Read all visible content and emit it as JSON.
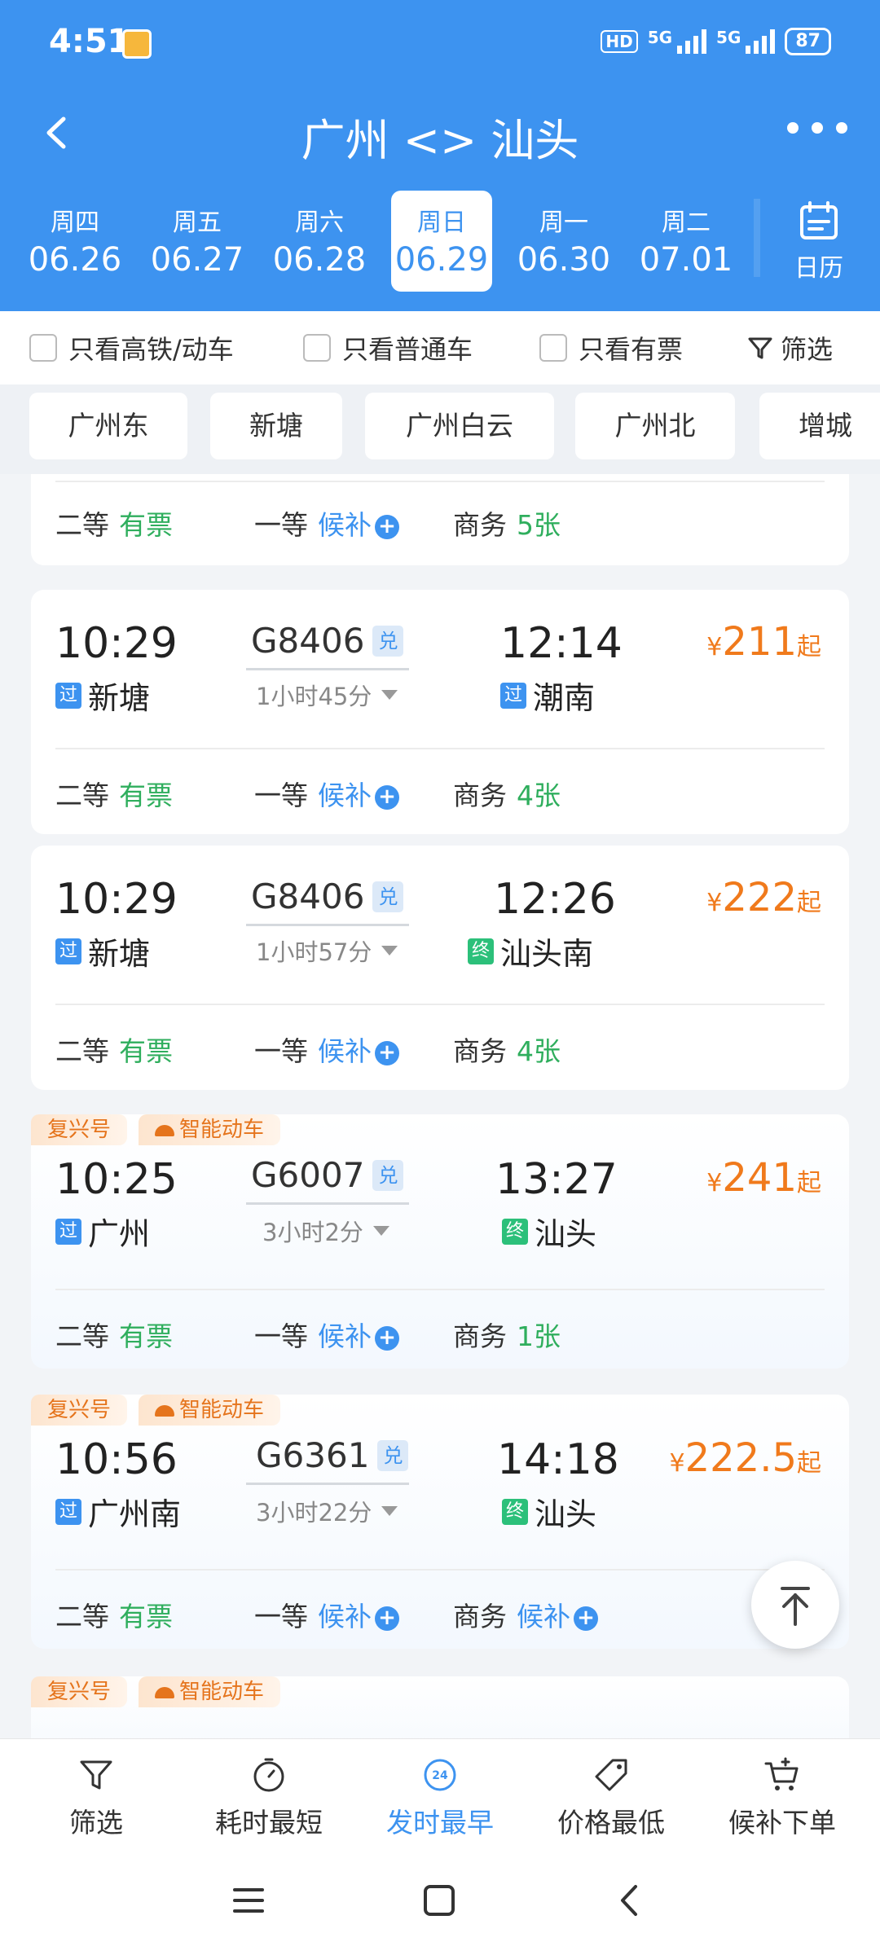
{
  "status": {
    "time": "4:51",
    "hd": "HD",
    "net1": "5G",
    "net2": "5G",
    "battery": "87"
  },
  "header": {
    "title": "广州 <> 汕头",
    "calendar_label": "日历"
  },
  "dates": [
    {
      "weekday": "周四",
      "date": "06.26",
      "selected": false
    },
    {
      "weekday": "周五",
      "date": "06.27",
      "selected": false
    },
    {
      "weekday": "周六",
      "date": "06.28",
      "selected": false
    },
    {
      "weekday": "周日",
      "date": "06.29",
      "selected": true
    },
    {
      "weekday": "周一",
      "date": "06.30",
      "selected": false
    },
    {
      "weekday": "周二",
      "date": "07.01",
      "selected": false
    }
  ],
  "filters": {
    "high_speed": "只看高铁/动车",
    "normal": "只看普通车",
    "available": "只看有票",
    "filter": "筛选"
  },
  "stations": [
    "广州东",
    "新塘",
    "广州白云",
    "广州北",
    "增城"
  ],
  "partial_card": {
    "seats": [
      {
        "class": "二等",
        "status": "有票",
        "type": "available"
      },
      {
        "class": "一等",
        "status": "候补",
        "type": "waitlist"
      },
      {
        "class": "商务",
        "status": "5张",
        "type": "available"
      }
    ]
  },
  "trains": [
    {
      "badges": [],
      "dep_time": "10:29",
      "dep_tag": "过",
      "dep_station": "新塘",
      "train_no": "G8406",
      "dui": "兑",
      "duration": "1小时45分",
      "arr_time": "12:14",
      "arr_tag": "过",
      "arr_station": "潮南",
      "price_currency": "¥",
      "price": "211",
      "price_suffix": "起",
      "seats": [
        {
          "class": "二等",
          "status": "有票",
          "type": "available"
        },
        {
          "class": "一等",
          "status": "候补",
          "type": "waitlist"
        },
        {
          "class": "商务",
          "status": "4张",
          "type": "available"
        }
      ]
    },
    {
      "badges": [],
      "dep_time": "10:29",
      "dep_tag": "过",
      "dep_station": "新塘",
      "train_no": "G8406",
      "dui": "兑",
      "duration": "1小时57分",
      "arr_time": "12:26",
      "arr_tag": "终",
      "arr_station": "汕头南",
      "price_currency": "¥",
      "price": "222",
      "price_suffix": "起",
      "seats": [
        {
          "class": "二等",
          "status": "有票",
          "type": "available"
        },
        {
          "class": "一等",
          "status": "候补",
          "type": "waitlist"
        },
        {
          "class": "商务",
          "status": "4张",
          "type": "available"
        }
      ]
    },
    {
      "badges": [
        "复兴号",
        "智能动车"
      ],
      "dep_time": "10:25",
      "dep_tag": "过",
      "dep_station": "广州",
      "train_no": "G6007",
      "dui": "兑",
      "duration": "3小时2分",
      "arr_time": "13:27",
      "arr_tag": "终",
      "arr_station": "汕头",
      "price_currency": "¥",
      "price": "241",
      "price_suffix": "起",
      "seats": [
        {
          "class": "二等",
          "status": "有票",
          "type": "available"
        },
        {
          "class": "一等",
          "status": "候补",
          "type": "waitlist"
        },
        {
          "class": "商务",
          "status": "1张",
          "type": "available"
        }
      ]
    },
    {
      "badges": [
        "复兴号",
        "智能动车"
      ],
      "dep_time": "10:56",
      "dep_tag": "过",
      "dep_station": "广州南",
      "train_no": "G6361",
      "dui": "兑",
      "duration": "3小时22分",
      "arr_time": "14:18",
      "arr_tag": "终",
      "arr_station": "汕头",
      "price_currency": "¥",
      "price": "222.5",
      "price_suffix": "起",
      "seats": [
        {
          "class": "二等",
          "status": "有票",
          "type": "available"
        },
        {
          "class": "一等",
          "status": "候补",
          "type": "waitlist"
        },
        {
          "class": "商务",
          "status": "候补",
          "type": "waitlist"
        }
      ]
    }
  ],
  "partial_bottom_card": {
    "badges": [
      "复兴号",
      "智能动车"
    ]
  },
  "bottom_bar": [
    {
      "label": "筛选",
      "icon": "filter-icon",
      "active": false
    },
    {
      "label": "耗时最短",
      "icon": "stopwatch-icon",
      "active": false
    },
    {
      "label": "发时最早",
      "icon": "clock-24-icon",
      "active": true
    },
    {
      "label": "价格最低",
      "icon": "price-tag-icon",
      "active": false
    },
    {
      "label": "候补下单",
      "icon": "cart-add-icon",
      "active": false
    }
  ],
  "colors": {
    "primary": "#3d93f0",
    "available": "#2fae5d",
    "price": "#f07a1c",
    "end_tag": "#2cc07a"
  }
}
